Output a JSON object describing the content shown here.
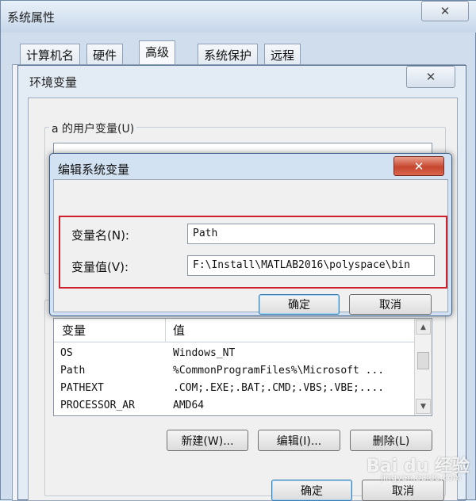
{
  "system_properties": {
    "title": "系统属性",
    "tabs": [
      {
        "label": "计算机名",
        "active": false
      },
      {
        "label": "硬件",
        "active": false
      },
      {
        "label": "高级",
        "active": true
      },
      {
        "label": "系统保护",
        "active": false
      },
      {
        "label": "远程",
        "active": false
      }
    ]
  },
  "env_window": {
    "title": "环境变量",
    "close_glyph": "✕",
    "user_vars_label": "a 的用户变量(U)",
    "system_vars": {
      "headers": [
        "变量",
        "值"
      ],
      "rows": [
        {
          "name": "OS",
          "value": "Windows_NT"
        },
        {
          "name": "Path",
          "value": "%CommonProgramFiles%\\Microsoft ..."
        },
        {
          "name": "PATHEXT",
          "value": ".COM;.EXE;.BAT;.CMD;.VBS;.VBE;...."
        },
        {
          "name": "PROCESSOR_AR",
          "value": "AMD64"
        }
      ],
      "new_button": "新建(W)...",
      "edit_button": "编辑(I)...",
      "delete_button": "删除(L)"
    },
    "ok_button": "确定",
    "cancel_button": "取消"
  },
  "edit_dialog": {
    "title": "编辑系统变量",
    "close_glyph": "✕",
    "name_label": "变量名(N):",
    "name_value": "Path",
    "value_label": "变量值(V):",
    "value_value": "F:\\Install\\MATLAB2016\\polyspace\\bin",
    "ok_button": "确定",
    "cancel_button": "取消"
  },
  "watermark": {
    "brand": "Bai du 经验",
    "sub": "jingyan.baidu.com"
  },
  "colors": {
    "highlight_border": "#d0202d",
    "close_button_red": "#c7472f"
  }
}
